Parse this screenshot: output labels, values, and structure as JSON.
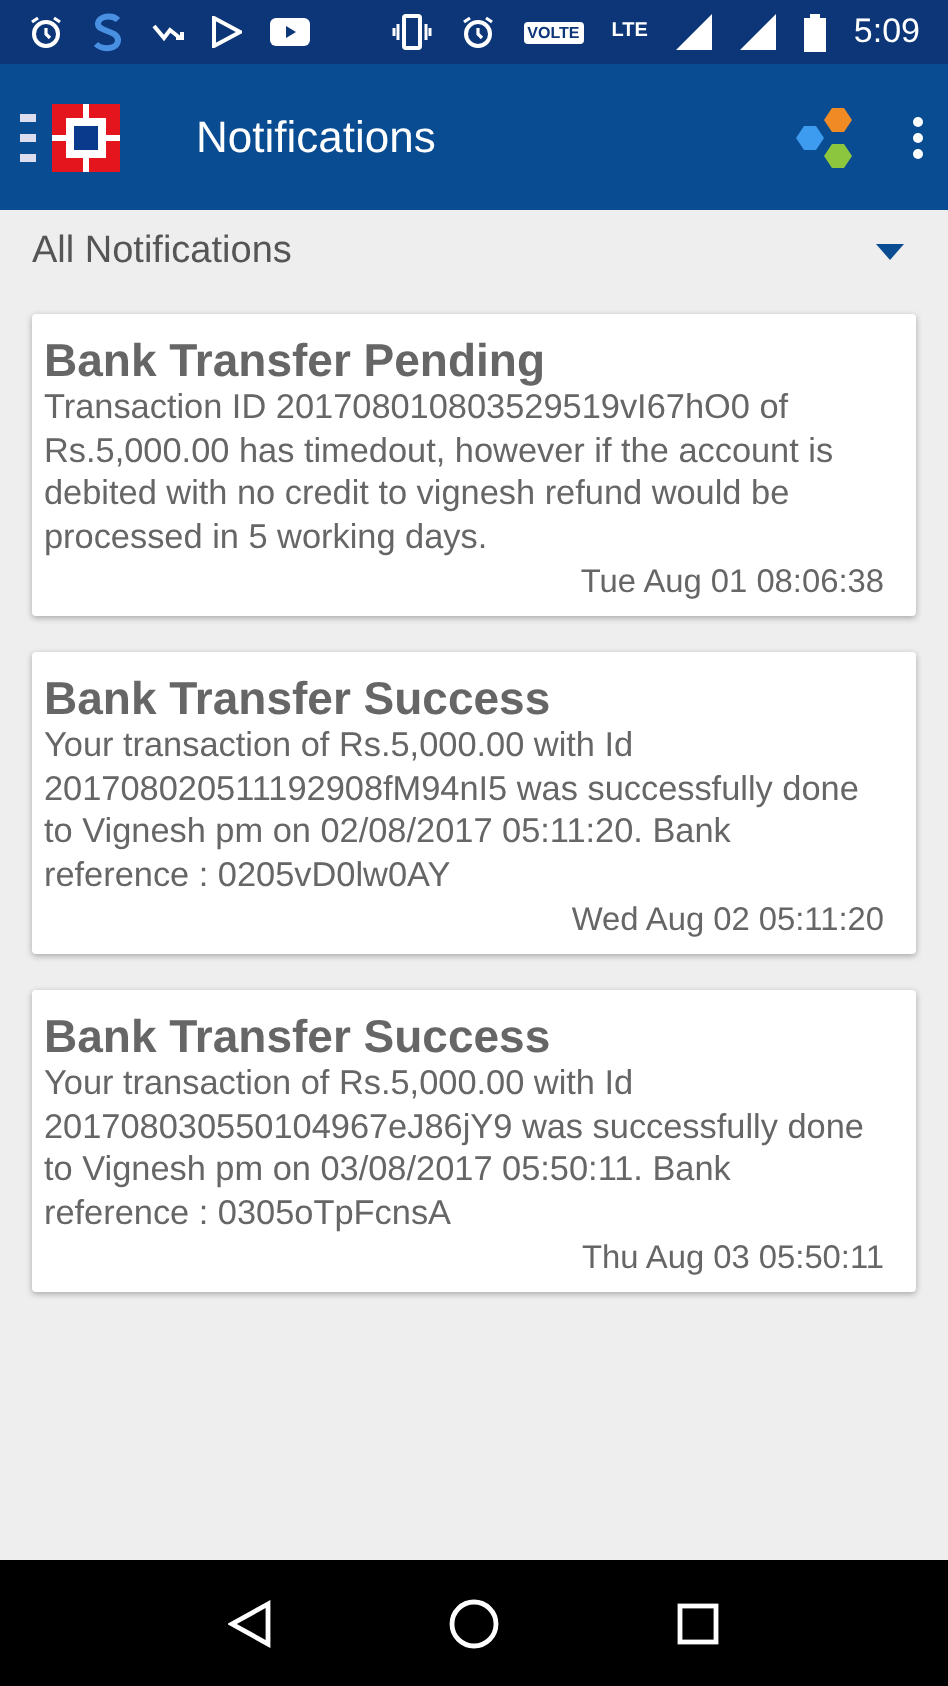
{
  "status_bar": {
    "volte": "VOLTE",
    "network": "LTE",
    "time": "5:09"
  },
  "app_bar": {
    "title": "Notifications"
  },
  "filter": {
    "value": "All Notifications"
  },
  "notifications": [
    {
      "title": "Bank Transfer Pending",
      "body": "Transaction ID 201708010803529519vI67hO0 of Rs.5,000.00 has timedout, however if the account is debited with no credit to vignesh refund would be processed in 5 working days.",
      "time": "Tue Aug 01 08:06:38"
    },
    {
      "title": "Bank Transfer Success",
      "body": "Your transaction of Rs.5,000.00 with Id 201708020511192908fM94nI5 was successfully done to Vignesh pm on 02/08/2017 05:11:20. Bank reference : 0205vD0lw0AY",
      "time": "Wed Aug 02 05:11:20"
    },
    {
      "title": "Bank Transfer Success",
      "body": "Your transaction of Rs.5,000.00 with Id 201708030550104967eJ86jY9 was successfully done to Vignesh pm on 03/08/2017 05:50:11. Bank reference : 0305oTpFcnsA",
      "time": "Thu Aug 03 05:50:11"
    }
  ]
}
